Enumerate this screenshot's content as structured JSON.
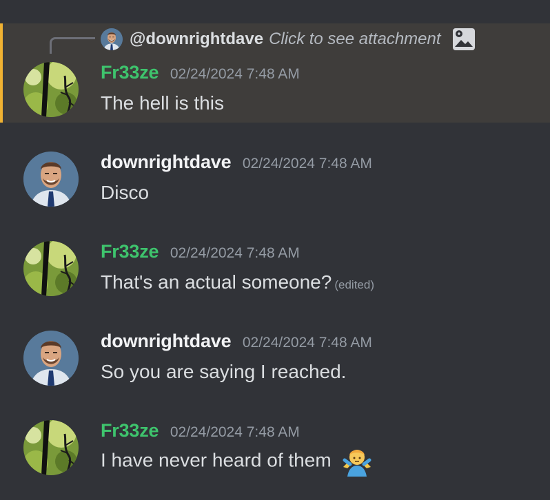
{
  "reply": {
    "mention": "@downrightdave",
    "text": "Click to see attachment",
    "icon": "image-icon"
  },
  "messages": [
    {
      "username": "Fr33ze",
      "timestamp": "02/24/2024 7:48 AM",
      "content": "The hell is this",
      "user_color": "#3ec46d",
      "avatar": "plant-avatar"
    },
    {
      "username": "downrightdave",
      "timestamp": "02/24/2024 7:48 AM",
      "content": "Disco",
      "user_color": "#f2f3f5",
      "avatar": "person-avatar"
    },
    {
      "username": "Fr33ze",
      "timestamp": "02/24/2024 7:48 AM",
      "content": "That's an actual someone?",
      "edited": "(edited)",
      "user_color": "#3ec46d",
      "avatar": "plant-avatar"
    },
    {
      "username": "downrightdave",
      "timestamp": "02/24/2024 7:48 AM",
      "content": "So you are saying I reached.",
      "user_color": "#f2f3f5",
      "avatar": "person-avatar"
    },
    {
      "username": "Fr33ze",
      "timestamp": "02/24/2024 7:48 AM",
      "content": "I have never heard of them",
      "emoji": "person-shrugging-emoji",
      "user_color": "#3ec46d",
      "avatar": "plant-avatar"
    }
  ],
  "colors": {
    "background": "#313338",
    "highlight_background": "#3f3d3b",
    "highlight_border": "#f0b232",
    "timestamp": "#949ba4",
    "text": "#dbdee1"
  }
}
